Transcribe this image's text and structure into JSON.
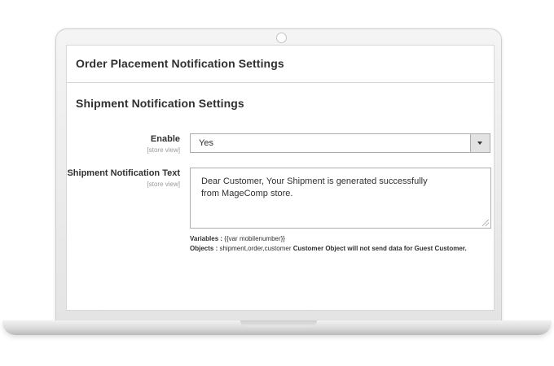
{
  "sections": {
    "order_title": "Order Placement Notification Settings",
    "shipment_title": "Shipment Notification Settings"
  },
  "fields": {
    "enable": {
      "label": "Enable",
      "scope": "[store view]",
      "value": "Yes"
    },
    "shipment_text": {
      "label": "Shipment Notification Text",
      "scope": "[store view]",
      "value": "Dear Customer, Your Shipment is generated successfully\nfrom MageComp store."
    }
  },
  "notes": {
    "variables_label": "Variables :",
    "variables_value": "{{var mobilenumber}}",
    "objects_label": "Objects :",
    "objects_value": "shipment,order,customer",
    "warning": "Customer Object will not send data for Guest Customer."
  },
  "icons": {
    "select_arrow": "chevron-down-icon",
    "resize_grip": "resize-handle-icon",
    "camera": "webcam-icon"
  },
  "colors": {
    "text": "#303030",
    "border": "#adadad",
    "scope_text": "#9a9a9a"
  }
}
